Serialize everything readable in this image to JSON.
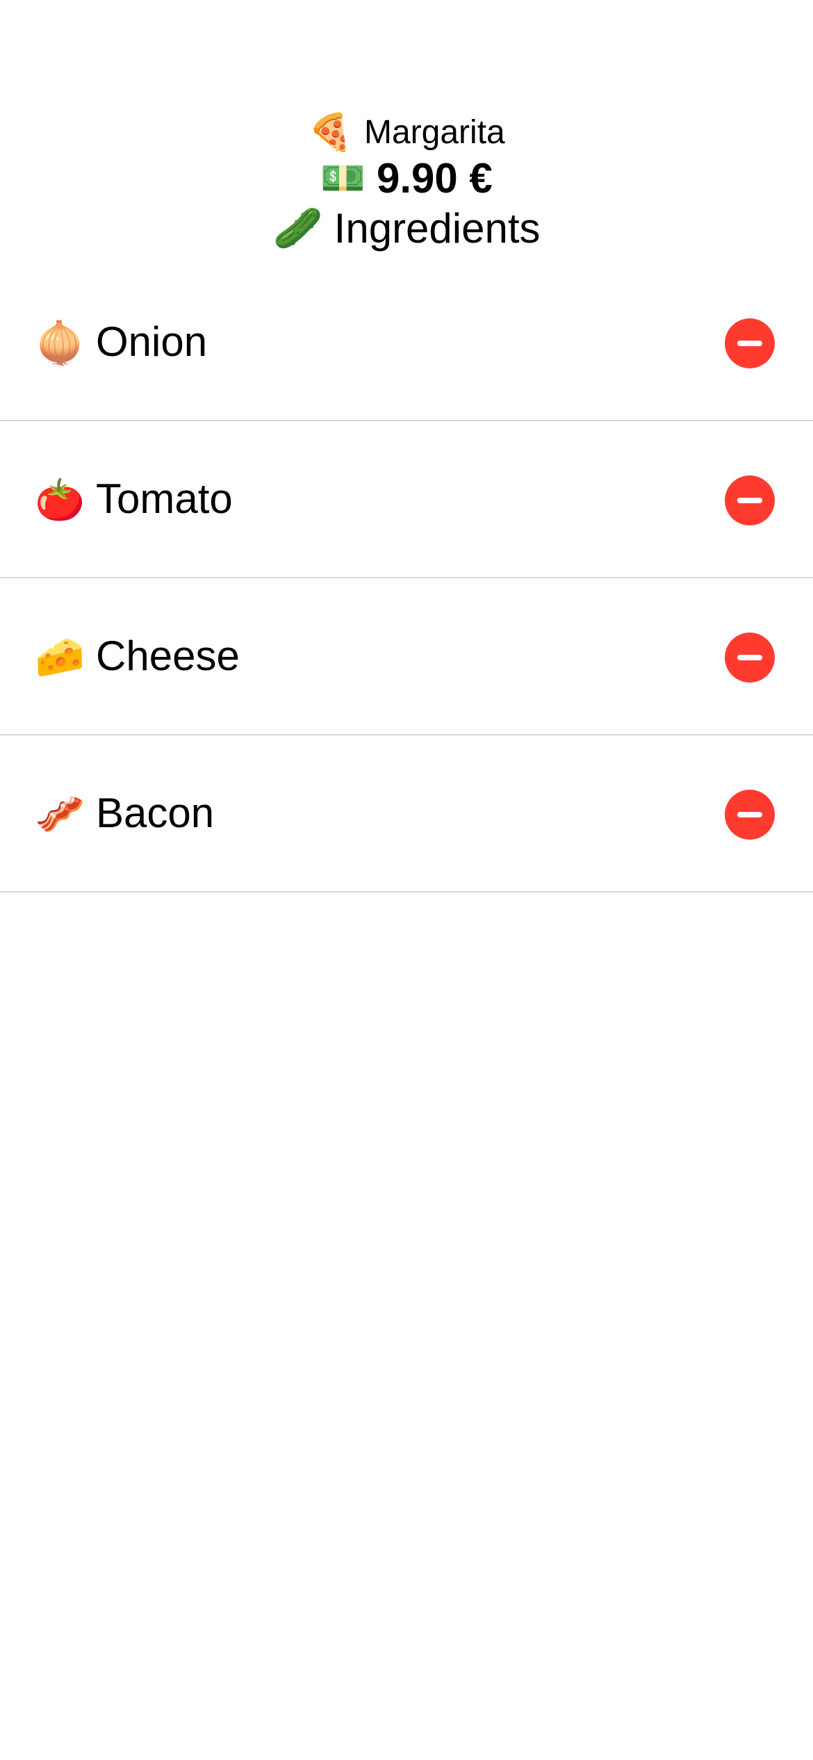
{
  "header": {
    "name_icon": "🍕",
    "name": "Margarita",
    "price_icon": "💵",
    "price": "9.90 €",
    "ingredients_icon": "🥒",
    "ingredients_label": "Ingredients"
  },
  "ingredients": [
    {
      "icon": "🧅",
      "label": "Onion"
    },
    {
      "icon": "🍅",
      "label": "Tomato"
    },
    {
      "icon": "🧀",
      "label": "Cheese"
    },
    {
      "icon": "🥓",
      "label": "Bacon"
    }
  ],
  "colors": {
    "remove": "#ff3b30",
    "separator": "#d8d8dc"
  },
  "icons": {
    "remove": "minus-circle-icon"
  }
}
